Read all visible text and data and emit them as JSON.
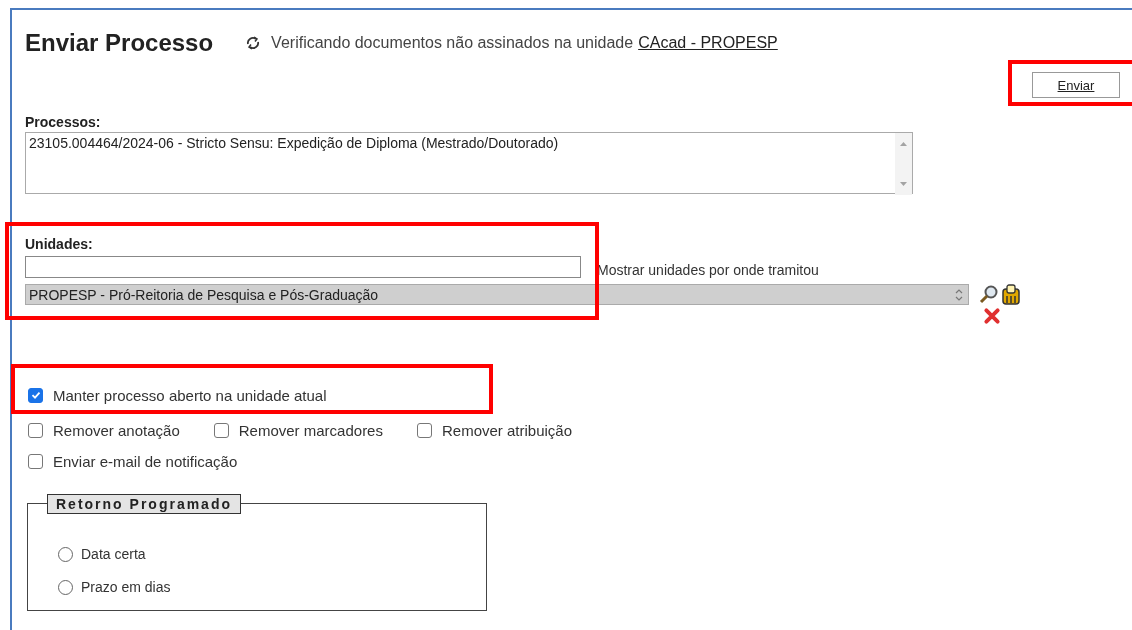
{
  "title": "Enviar Processo",
  "verification": {
    "text": "Verificando documentos não assinados na unidade",
    "unit_link": "CAcad - PROPESP"
  },
  "send_button": {
    "label": "Enviar",
    "highlighted": true
  },
  "processos": {
    "label": "Processos:",
    "items": [
      {
        "number": "23105.004464/2024-06",
        "separator": "-",
        "description": "Stricto Sensu: Expedição de Diploma (Mestrado/Doutorado)"
      }
    ]
  },
  "unidades": {
    "label": "Unidades:",
    "highlighted": true,
    "show_units_label": "Mostrar unidades por onde tramitou",
    "selected_units": [
      "PROPESP - Pró-Reitoria de Pesquisa e Pós-Graduação"
    ]
  },
  "option_rows": [
    [
      {
        "label": "Manter processo aberto na unidade atual",
        "checked": true,
        "highlighted": true
      }
    ],
    [
      {
        "label": "Remover anotação",
        "checked": false,
        "highlighted": false
      },
      {
        "label": "Remover marcadores",
        "checked": false,
        "highlighted": false
      },
      {
        "label": "Remover atribuição",
        "checked": false,
        "highlighted": false
      }
    ],
    [
      {
        "label": "Enviar e-mail de notificação",
        "checked": false,
        "highlighted": false
      }
    ]
  ],
  "retorno_programado": {
    "legend": "Retorno Programado",
    "choices": [
      {
        "label": "Data certa",
        "selected": false
      },
      {
        "label": "Prazo em dias",
        "selected": false
      }
    ]
  }
}
